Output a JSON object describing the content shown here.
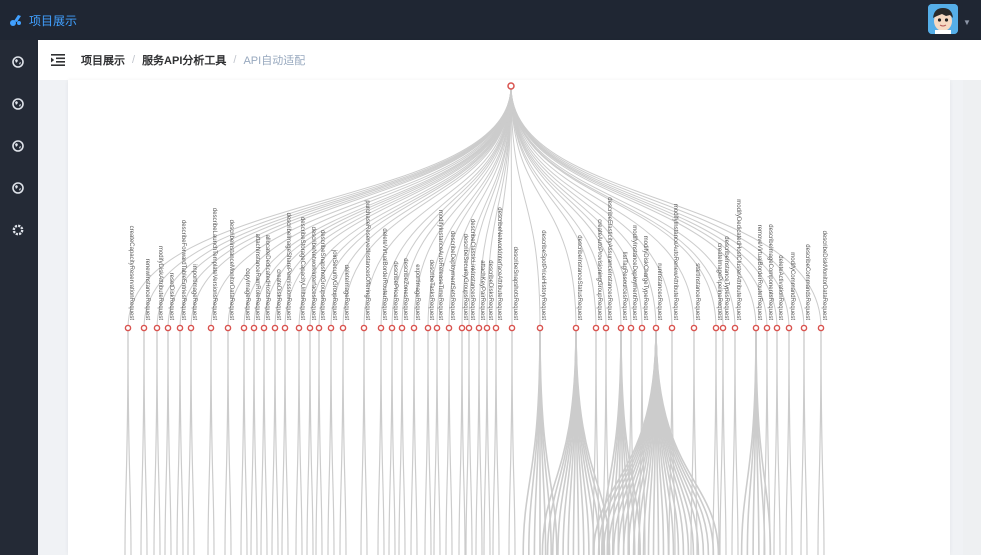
{
  "app": {
    "title": "项目展示"
  },
  "sidebar": {
    "items": [
      {
        "icon": "globe-icon"
      },
      {
        "icon": "globe-icon"
      },
      {
        "icon": "globe-icon"
      },
      {
        "icon": "globe-icon"
      },
      {
        "icon": "settings-icon"
      }
    ]
  },
  "header": {
    "avatar_icon": "user-avatar"
  },
  "breadcrumb": {
    "items": [
      "项目展示",
      "服务API分析工具",
      "API自动适配"
    ],
    "separator": "/"
  },
  "colors": {
    "sidebar": "#242a36",
    "header": "#1f2633",
    "accent": "#41a0ff",
    "node": "#d9534f",
    "link": "#cccccc",
    "label": "#555555"
  },
  "tree": {
    "leaves": [
      "createCapacityReservationRequest",
      "renewInstanceRequest",
      "modifyDiskAttributeRequest",
      "resetDiskRequest",
      "describeForwardTableEntriesRequest",
      "importImageRequest",
      "describeLaunchTemplateVersionsRequest",
      "describeInstanceMonitorDataRequest",
      "copyImageRequest",
      "attachInstanceRamRoleRequest",
      "allocateDedicatedHostsRequest",
      "createDiskRequest",
      "describeImageSharePermissionRequest",
      "describeStorageCapacityUnitsRequest",
      "describeNetworkInterfacesRequest",
      "describeSnapshotGroupsRequest",
      "joinSecurityGroupRequest",
      "deleteImageRequest",
      "purchaseReservedInstancesOfferingRequest",
      "deleteVirtualBorderRouterRequest",
      "describePriceRequest",
      "describeZonesRequest",
      "exportImageRequest",
      "describeTasksRequest",
      "modifyInstanceAutoReleaseTimeRequest",
      "describeDeploymentSetsRequest",
      "describeSecurityGroupsRequest",
      "describeClassicLinkInstancesRequest",
      "attachKeyPairRequest",
      "describeDisksRequest",
      "describeNetworkInterfaceAttributeRequest",
      "describeSnapshotsRequest",
      "describeSpotPriceHistoryRequest",
      "describeInstanceStatusRequest",
      "createAutoProvisioningGroupRequest",
      "describeElasticityAssuranceInstancesRequest",
      "listTagResourcesRequest",
      "modifyInstanceDeploymentRequest",
      "modifyDiskChargeTypeRequest",
      "runInstancesRequest",
      "modifyInstanceAutoRenewAttributeRequest",
      "startInstanceRequest",
      "createImagePipelineRequest",
      "describeInstanceTypesRequest",
      "modifyDedicatedHostClusterAttributeRequest",
      "removeVirtualBorderRouterRequest",
      "describeImageComponentsRequest",
      "deleteActivationRequest",
      "modifyCommandRequest",
      "describeCommandsRequest",
      "describeDiskMonitorDataRequest"
    ]
  }
}
